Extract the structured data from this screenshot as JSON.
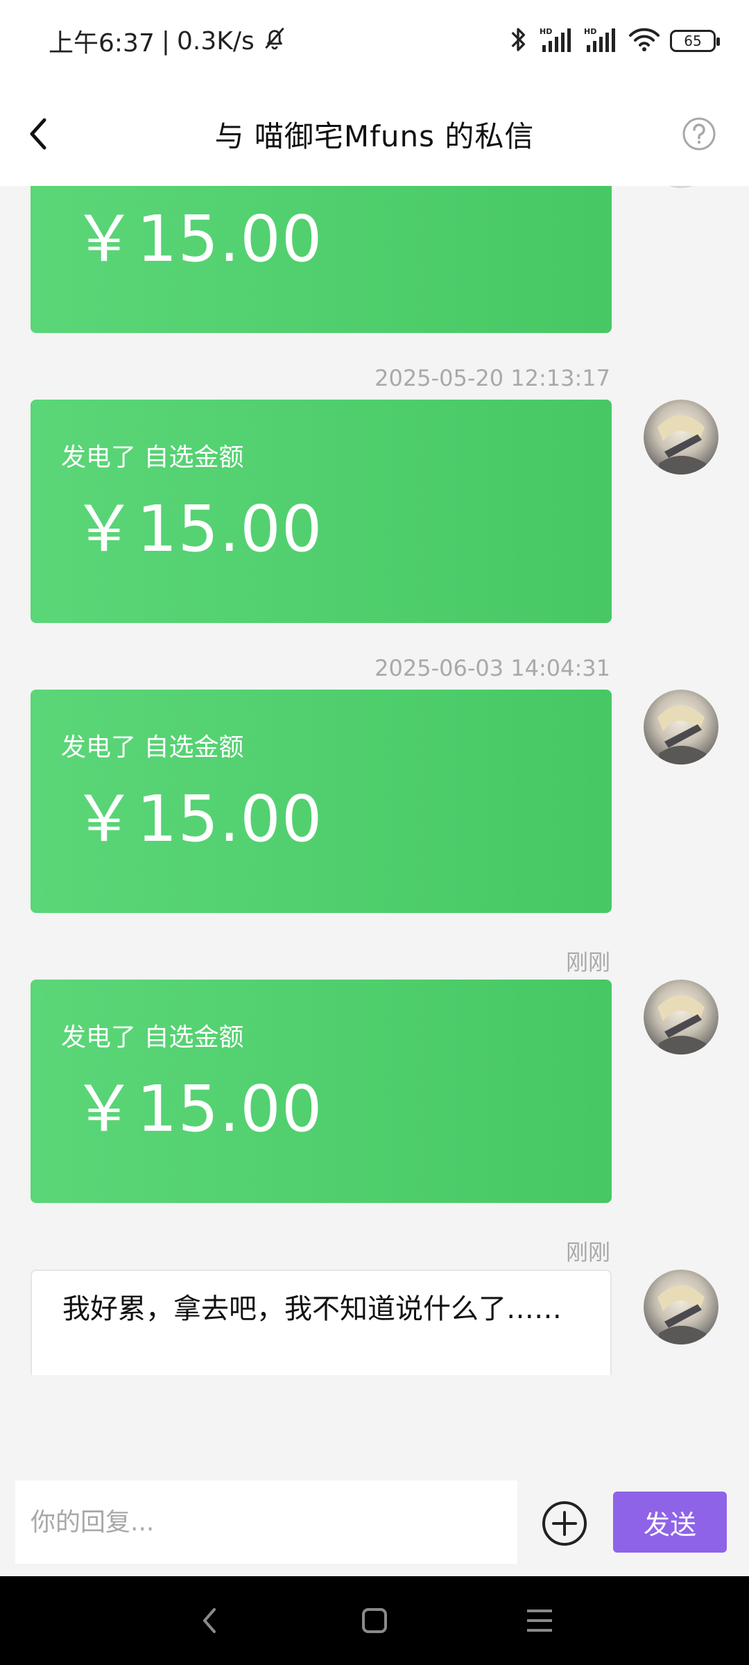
{
  "status_bar": {
    "time": "上午6:37",
    "net_speed": "0.3K/s",
    "battery": "65",
    "icons": [
      "mute-bell-icon",
      "bluetooth-icon",
      "hd-signal-icon",
      "hd-signal-icon",
      "wifi-icon",
      "battery-icon"
    ]
  },
  "header": {
    "title": "与 喵御宅Mfuns 的私信",
    "back_icon": "back-arrow-icon",
    "help_icon": "help-icon"
  },
  "messages": [
    {
      "timestamp": "",
      "card_title": "",
      "amount": "￥15.00"
    },
    {
      "timestamp": "2025-05-20 12:13:17",
      "card_title": "发电了 自选金额",
      "amount": "￥15.00"
    },
    {
      "timestamp": "2025-06-03 14:04:31",
      "card_title": "发电了 自选金额",
      "amount": "￥15.00"
    },
    {
      "timestamp": "刚刚",
      "card_title": "发电了 自选金额",
      "amount": "￥15.00"
    }
  ],
  "text_message": {
    "timestamp": "刚刚",
    "text": "我好累，拿去吧，我不知道说什么了……"
  },
  "input": {
    "placeholder": "你的回复...",
    "send_label": "发送",
    "plus_icon": "plus-circle-icon"
  },
  "nav_bar": {
    "icons": [
      "nav-back-icon",
      "nav-home-icon",
      "nav-menu-icon"
    ]
  },
  "colors": {
    "card_green": "#4fcf6d",
    "send_purple": "#8f63e8",
    "timestamp_gray": "#a9a9a9"
  }
}
